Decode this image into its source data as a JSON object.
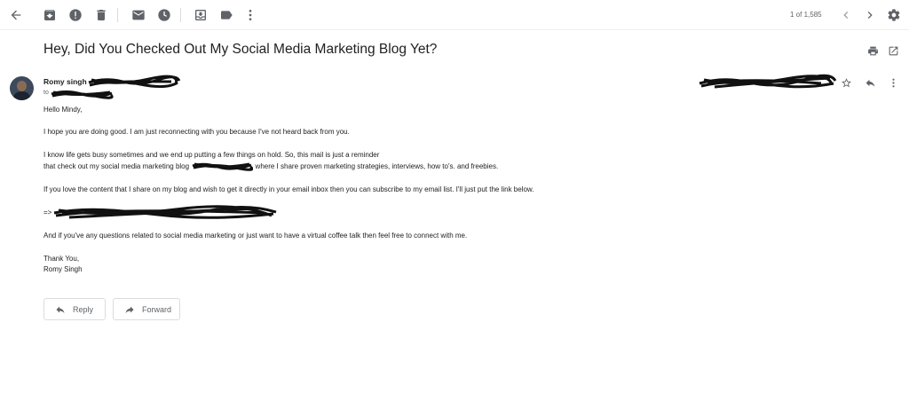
{
  "toolbar": {
    "icons": [
      "back-arrow-icon",
      "archive-icon",
      "report-spam-icon",
      "delete-icon",
      "mark-unread-icon",
      "snooze-icon",
      "move-to-icon",
      "label-icon",
      "more-vert-icon"
    ],
    "pager_text": "1 of 1,585"
  },
  "email": {
    "subject": "Hey, Did You Checked Out My Social Media Marketing Blog Yet?",
    "sender_name": "Romy singh",
    "to_label": "to",
    "greeting": "Hello Mindy,",
    "p1": "I hope you are doing good. I am just reconnecting with you because I've not heard back from you.",
    "p2_line1": "I know life gets busy sometimes and we end up putting a few things on hold. So, this mail is just a reminder",
    "p2_line2_start": "that check out my social media marketing blog",
    "p2_line2_end": "where I share proven marketing strategies, interviews, how to's. and freebies.",
    "p3": "If you love the content that I share on my blog and wish to get it directly in your email inbox then you can subscribe to my email list. I'll just put the link below.",
    "arrow": "=>",
    "p4": "And if you've any questions related to social media marketing or just want to have a virtual coffee talk then feel free to connect with me.",
    "sign1": "Thank You,",
    "sign2": "Romy Singh"
  },
  "actions": {
    "reply_label": "Reply",
    "forward_label": "Forward"
  }
}
